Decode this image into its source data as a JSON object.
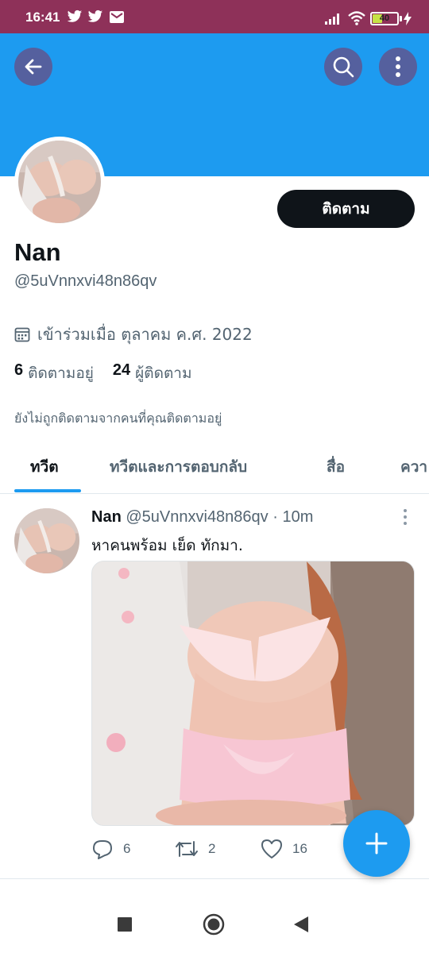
{
  "status_bar": {
    "time": "16:41",
    "battery": "40",
    "battery_level": 0.4,
    "icons": [
      "twitter-icon",
      "twitter-icon",
      "mail-icon",
      "signal-icon",
      "wifi-icon",
      "battery-icon",
      "charging-icon"
    ]
  },
  "header": {
    "banner_color": "#1d9bf0",
    "back_icon": "arrow-left-icon",
    "search_icon": "search-icon",
    "more_icon": "more-vertical-icon"
  },
  "profile": {
    "follow_label": "ติดตาม",
    "display_name": "Nan",
    "handle": "@5uVnnxvi48n86qv",
    "joined": "เข้าร่วมเมื่อ ตุลาคม ค.ศ. 2022",
    "following_count": "6",
    "following_label": "ติดตามอยู่",
    "followers_count": "24",
    "followers_label": "ผู้ติดตาม",
    "not_followed_text": "ยังไม่ถูกติดตามจากคนที่คุณติดตามอยู่"
  },
  "tabs": [
    {
      "label": "ทวีต",
      "active": true
    },
    {
      "label": "ทวีตและการตอบกลับ",
      "active": false
    },
    {
      "label": "สื่อ",
      "active": false
    },
    {
      "label": "ควา",
      "active": false
    }
  ],
  "tweet": {
    "name": "Nan",
    "meta": "@5uVnnxvi48n86qv · 10m",
    "text": "หาคนพร้อม เย็ด  ทักมา.",
    "replies": "6",
    "retweets": "2",
    "likes": "16"
  },
  "fab_icon": "plus-icon",
  "nav": {
    "recents_icon": "square-icon",
    "home_icon": "circle-home-icon",
    "back_icon": "triangle-back-icon"
  },
  "colors": {
    "status_bar": "#8e3159",
    "accent": "#1d9bf0",
    "button_dark": "#0f1419",
    "secondary_text": "#536471"
  }
}
